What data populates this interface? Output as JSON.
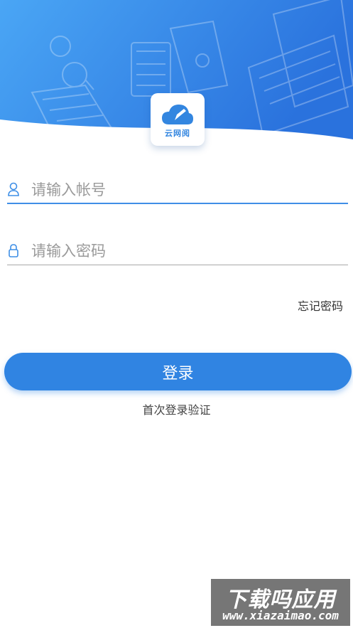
{
  "brand": {
    "logo_text": "云网阅"
  },
  "login_form": {
    "account_placeholder": "请输入帐号",
    "password_placeholder": "请输入密码",
    "forgot_password": "忘记密码",
    "login_button": "登录",
    "first_login_verify": "首次登录验证"
  },
  "watermark": {
    "title": "下载吗应用",
    "url": "www.xiazaimao.com"
  },
  "colors": {
    "primary": "#3084e2",
    "hero_gradient_start": "#4aa6f5",
    "hero_gradient_end": "#2a72dd",
    "account_underline": "#3f8fe6"
  },
  "icons": {
    "account": "user-icon",
    "password": "lock-icon",
    "logo": "cloud-pen-icon"
  }
}
